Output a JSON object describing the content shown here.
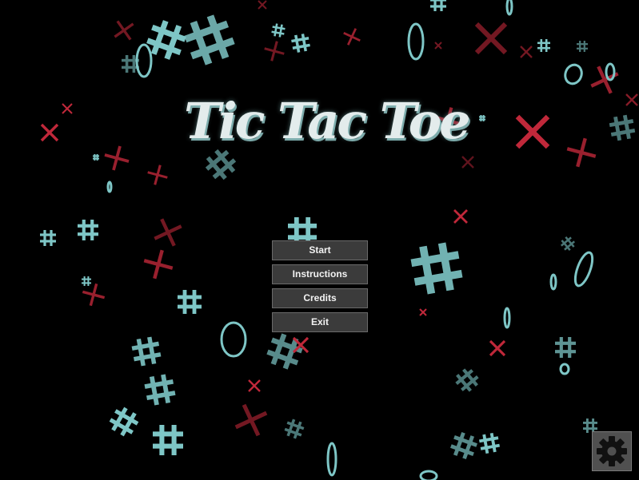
{
  "game": {
    "title": "Tic Tac Toe"
  },
  "menu": {
    "items": [
      {
        "label": "Start"
      },
      {
        "label": "Instructions"
      },
      {
        "label": "Credits"
      },
      {
        "label": "Exit"
      }
    ]
  },
  "settings": {
    "icon": "gear-icon"
  },
  "colors": {
    "background": "#000000",
    "board_teal": "#7ec6c6",
    "x_red": "#c0283a",
    "button_bg": "#3b3b3b",
    "button_text": "#f2f2f2"
  }
}
